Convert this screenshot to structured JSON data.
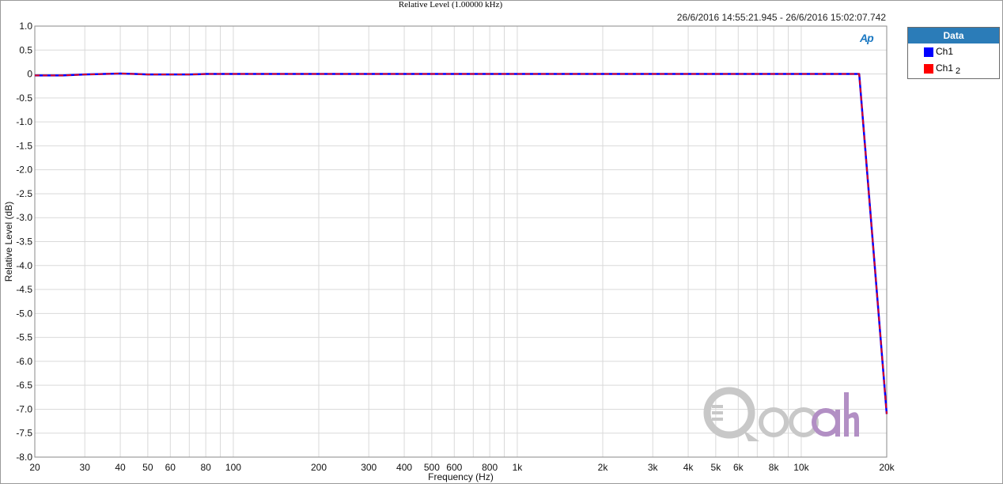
{
  "chart_data": {
    "type": "line",
    "title": "Relative Level (1.00000 kHz)",
    "timestamp": "26/6/2016 14:55:21.945 - 26/6/2016 15:02:07.742",
    "xlabel": "Frequency (Hz)",
    "ylabel": "Relative Level (dB)",
    "x_scale": "log",
    "xlim": [
      20,
      20000
    ],
    "ylim": [
      -8.0,
      1.0
    ],
    "grid": true,
    "x_ticks": [
      {
        "value": 20,
        "label": "20"
      },
      {
        "value": 30,
        "label": "30"
      },
      {
        "value": 40,
        "label": "40"
      },
      {
        "value": 50,
        "label": "50"
      },
      {
        "value": 60,
        "label": "60"
      },
      {
        "value": 80,
        "label": "80"
      },
      {
        "value": 100,
        "label": "100"
      },
      {
        "value": 200,
        "label": "200"
      },
      {
        "value": 300,
        "label": "300"
      },
      {
        "value": 400,
        "label": "400"
      },
      {
        "value": 500,
        "label": "500"
      },
      {
        "value": 600,
        "label": "600"
      },
      {
        "value": 800,
        "label": "800"
      },
      {
        "value": 1000,
        "label": "1k"
      },
      {
        "value": 2000,
        "label": "2k"
      },
      {
        "value": 3000,
        "label": "3k"
      },
      {
        "value": 4000,
        "label": "4k"
      },
      {
        "value": 5000,
        "label": "5k"
      },
      {
        "value": 6000,
        "label": "6k"
      },
      {
        "value": 8000,
        "label": "8k"
      },
      {
        "value": 10000,
        "label": "10k"
      },
      {
        "value": 20000,
        "label": "20k"
      }
    ],
    "y_ticks": [
      {
        "value": 1.0,
        "label": "1.0"
      },
      {
        "value": 0.5,
        "label": "0.5"
      },
      {
        "value": 0,
        "label": "0"
      },
      {
        "value": -0.5,
        "label": "-0.5"
      },
      {
        "value": -1.0,
        "label": "-1.0"
      },
      {
        "value": -1.5,
        "label": "-1.5"
      },
      {
        "value": -2.0,
        "label": "-2.0"
      },
      {
        "value": -2.5,
        "label": "-2.5"
      },
      {
        "value": -3.0,
        "label": "-3.0"
      },
      {
        "value": -3.5,
        "label": "-3.5"
      },
      {
        "value": -4.0,
        "label": "-4.0"
      },
      {
        "value": -4.5,
        "label": "-4.5"
      },
      {
        "value": -5.0,
        "label": "-5.0"
      },
      {
        "value": -5.5,
        "label": "-5.5"
      },
      {
        "value": -6.0,
        "label": "-6.0"
      },
      {
        "value": -6.5,
        "label": "-6.5"
      },
      {
        "value": -7.0,
        "label": "-7.0"
      },
      {
        "value": -7.5,
        "label": "-7.5"
      },
      {
        "value": -8.0,
        "label": "-8.0"
      }
    ],
    "legend": {
      "title": "Data",
      "placement": "right",
      "items": [
        {
          "label": "Ch1",
          "sub": "",
          "color": "#0000ff"
        },
        {
          "label": "Ch1",
          "sub": "2",
          "color": "#ff0000"
        }
      ]
    },
    "series": [
      {
        "color": "#0000ff",
        "style": "solid",
        "x": [
          20,
          25,
          30,
          35,
          40,
          45,
          50,
          60,
          70,
          80,
          100,
          200,
          500,
          1000,
          2000,
          5000,
          10000,
          15000,
          16000,
          20000
        ],
        "y": [
          -0.03,
          -0.03,
          -0.01,
          0.0,
          0.01,
          0.0,
          -0.01,
          -0.01,
          -0.01,
          0.0,
          0.0,
          0.0,
          0.0,
          0.0,
          0.0,
          0.0,
          0.0,
          0.0,
          0.0,
          -7.1
        ]
      },
      {
        "color": "#ff0000",
        "style": "dashed",
        "x": [
          20,
          25,
          30,
          35,
          40,
          45,
          50,
          60,
          70,
          80,
          100,
          200,
          500,
          1000,
          2000,
          5000,
          10000,
          15000,
          16000,
          20000
        ],
        "y": [
          -0.03,
          -0.03,
          -0.01,
          0.0,
          0.01,
          0.0,
          -0.01,
          -0.01,
          -0.01,
          0.0,
          0.0,
          0.0,
          0.0,
          0.0,
          0.0,
          0.0,
          0.0,
          0.0,
          0.0,
          -7.1
        ]
      }
    ]
  },
  "logos": {
    "ap": "Ap",
    "watermark": "Qooah"
  },
  "colors": {
    "grid": "#d9d9d9",
    "legend_header": "#2b7cb8",
    "watermark_gray": "#c8c8c8",
    "watermark_purple": "#b28fc4"
  }
}
